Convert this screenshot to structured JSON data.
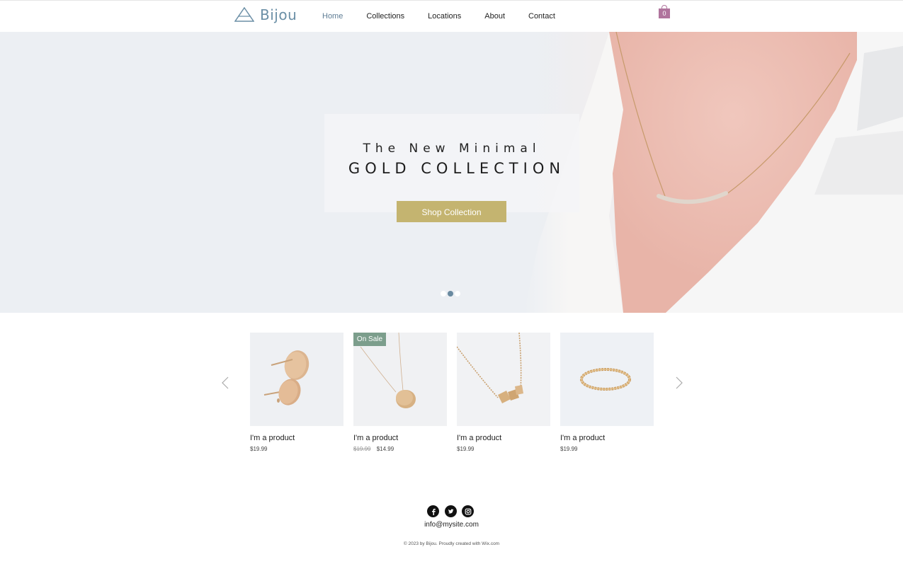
{
  "header": {
    "logo_text": "Bijou",
    "nav": [
      {
        "label": "Home",
        "active": true
      },
      {
        "label": "Collections",
        "active": false
      },
      {
        "label": "Locations",
        "active": false
      },
      {
        "label": "About",
        "active": false
      },
      {
        "label": "Contact",
        "active": false
      }
    ],
    "cart_count": "0"
  },
  "hero": {
    "subtitle": "The New Minimal",
    "title": "GOLD COLLECTION",
    "button_label": "Shop Collection",
    "slides": 3,
    "active_slide": 2
  },
  "products": [
    {
      "name": "I'm a product",
      "price": "$19.99",
      "old_price": "",
      "badge": "",
      "image": "gold-stud-earrings"
    },
    {
      "name": "I'm a product",
      "price": "$14.99",
      "old_price": "$19.99",
      "badge": "On Sale",
      "image": "gold-disc-necklace"
    },
    {
      "name": "I'm a product",
      "price": "$19.99",
      "old_price": "",
      "badge": "",
      "image": "gold-cube-necklace"
    },
    {
      "name": "I'm a product",
      "price": "$19.99",
      "old_price": "",
      "badge": "",
      "image": "gold-twisted-ring"
    }
  ],
  "footer": {
    "social": [
      "facebook-icon",
      "twitter-icon",
      "instagram-icon"
    ],
    "email": "info@mysite.com",
    "copyright": "© 2023 by Bijou. Proudly created with Wix.com"
  },
  "colors": {
    "brand": "#6b8fa6",
    "button": "#c4b470",
    "sale_badge": "#7c9e8c",
    "cart": "#b0749d"
  }
}
